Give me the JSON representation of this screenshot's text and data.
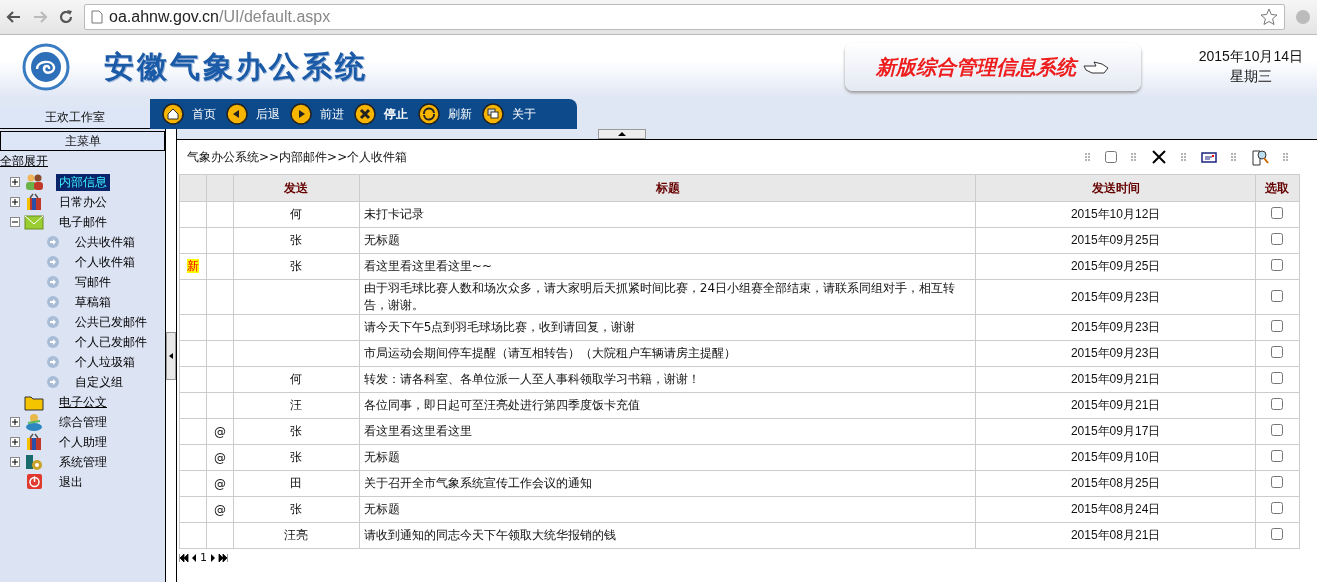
{
  "browser": {
    "url_host": "oa.ahnw.gov.cn",
    "url_path": "/UI/default.aspx"
  },
  "header": {
    "title": "安徽气象办公系统",
    "banner": "新版综合管理信息系统",
    "date": "2015年10月14日",
    "weekday": "星期三"
  },
  "workspace_tab": "王欢工作室",
  "nav": [
    {
      "label": "首页",
      "kind": "home"
    },
    {
      "label": "后退",
      "kind": "back"
    },
    {
      "label": "前进",
      "kind": "forward"
    },
    {
      "label": "停止",
      "kind": "stop"
    },
    {
      "label": "刷新",
      "kind": "refresh"
    },
    {
      "label": "关于",
      "kind": "about"
    }
  ],
  "sidebar": {
    "title": "主菜单",
    "expand_all": "全部展开",
    "items": [
      {
        "label": "内部信息",
        "kind": "people",
        "expanded": false,
        "selected": true
      },
      {
        "label": "日常办公",
        "kind": "gift",
        "expanded": false,
        "selected": false
      },
      {
        "label": "电子邮件",
        "kind": "mail",
        "expanded": true,
        "selected": false,
        "children": [
          {
            "label": "公共收件箱",
            "selected": false
          },
          {
            "label": "个人收件箱",
            "selected": false
          },
          {
            "label": "写邮件",
            "selected": false
          },
          {
            "label": "草稿箱",
            "selected": false
          },
          {
            "label": "公共已发邮件",
            "selected": false
          },
          {
            "label": "个人已发邮件",
            "selected": false
          },
          {
            "label": "个人垃圾箱",
            "selected": false
          },
          {
            "label": "自定义组",
            "selected": false
          }
        ]
      },
      {
        "label": "电子公文",
        "kind": "folder",
        "selected": false
      },
      {
        "label": "综合管理",
        "kind": "person",
        "expanded": false,
        "selected": false
      },
      {
        "label": "个人助理",
        "kind": "gift",
        "expanded": false,
        "selected": false
      },
      {
        "label": "系统管理",
        "kind": "tools",
        "expanded": false,
        "selected": false
      },
      {
        "label": "退出",
        "kind": "exit",
        "selected": false
      }
    ]
  },
  "breadcrumb": "气象办公系统>>内部邮件>>个人收件箱",
  "select_all": {
    "checked": false
  },
  "table": {
    "columns": [
      "发送",
      "标题",
      "发送时间",
      "选取"
    ],
    "rows": [
      {
        "sender": "何",
        "title": "未打卡记录",
        "time": "2015年10月12日",
        "checked": false
      },
      {
        "sender": "张",
        "title": "无标题",
        "time": "2015年09月25日",
        "checked": false
      },
      {
        "flag": "新",
        "sender": "张",
        "title": "看这里看这里看这里~~",
        "time": "2015年09月25日",
        "checked": false
      },
      {
        "title": "由于羽毛球比赛人数和场次众多，请大家明后天抓紧时间比赛，24日小组赛全部结束，请联系同组对手，相互转告，谢谢。",
        "time": "2015年09月23日",
        "checked": false
      },
      {
        "title": "请今天下午5点到羽毛球场比赛，收到请回复，谢谢",
        "time": "2015年09月23日",
        "checked": false
      },
      {
        "title": "市局运动会期间停车提醒（请互相转告）（大院租户车辆请房主提醒）",
        "time": "2015年09月23日",
        "checked": false
      },
      {
        "sender": "何",
        "title": "转发：请各科室、各单位派一人至人事科领取学习书籍，谢谢！",
        "time": "2015年09月21日",
        "checked": false
      },
      {
        "sender": "汪",
        "title": "各位同事，即日起可至汪亮处进行第四季度饭卡充值",
        "time": "2015年09月21日",
        "checked": false
      },
      {
        "attach": "@",
        "sender": "张",
        "title": "看这里看这里看这里",
        "time": "2015年09月17日",
        "checked": false
      },
      {
        "attach": "@",
        "sender": "张",
        "title": "无标题",
        "time": "2015年09月10日",
        "checked": false
      },
      {
        "attach": "@",
        "sender": "田",
        "title": "关于召开全市气象系统宣传工作会议的通知",
        "time": "2015年08月25日",
        "checked": false
      },
      {
        "attach": "@",
        "sender": "张",
        "title": "无标题",
        "time": "2015年08月24日",
        "checked": false
      },
      {
        "sender": "汪亮",
        "title": "请收到通知的同志今天下午领取大统华报销的钱",
        "time": "2015年08月21日",
        "checked": false
      }
    ]
  },
  "pager": {
    "page": "1"
  }
}
